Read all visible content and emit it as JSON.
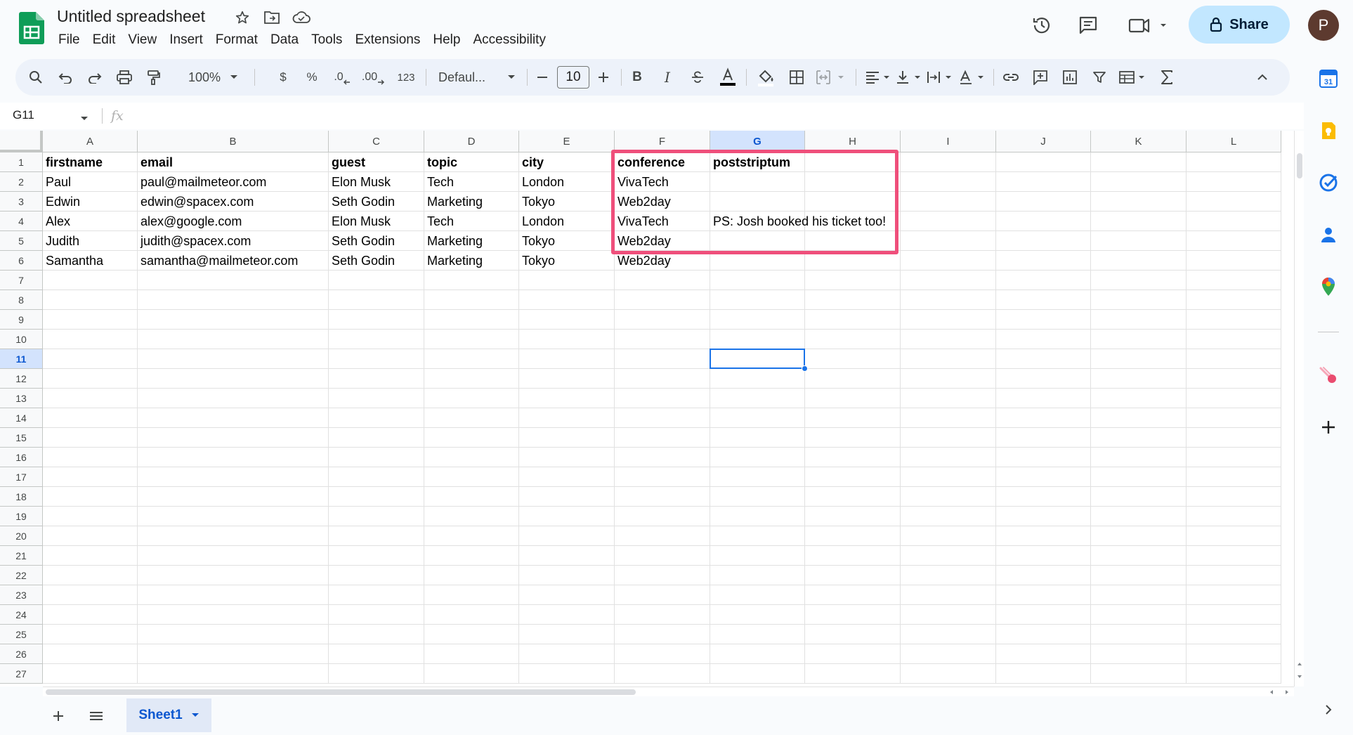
{
  "doc": {
    "title": "Untitled spreadsheet"
  },
  "menu": [
    "File",
    "Edit",
    "View",
    "Insert",
    "Format",
    "Data",
    "Tools",
    "Extensions",
    "Help",
    "Accessibility"
  ],
  "header": {
    "share_label": "Share",
    "avatar_initial": "P"
  },
  "toolbar": {
    "zoom": "100%",
    "currency": "$",
    "percent": "%",
    "decimal_decrease": ".0",
    "decimal_increase": ".00",
    "number_format": "123",
    "font": "Defaul...",
    "font_size": "10",
    "bold": "B",
    "italic": "I"
  },
  "formula": {
    "cell_ref": "G11",
    "fx": "fx"
  },
  "columns": [
    "A",
    "B",
    "C",
    "D",
    "E",
    "F",
    "G",
    "H",
    "I",
    "J",
    "K",
    "L"
  ],
  "selected_column": "G",
  "row_numbers": [
    "1",
    "2",
    "3",
    "4",
    "5",
    "6",
    "7",
    "8",
    "9",
    "10",
    "11",
    "12",
    "13",
    "14",
    "15",
    "16",
    "17",
    "18",
    "19",
    "20",
    "21",
    "22",
    "23",
    "24",
    "25",
    "26",
    "27"
  ],
  "selected_row": "11",
  "cells": [
    [
      "firstname",
      "email",
      "guest",
      "topic",
      "city",
      "conference",
      "poststriptum"
    ],
    [
      "Paul",
      "paul@mailmeteor.com",
      "Elon Musk",
      "Tech",
      "London",
      "VivaTech",
      ""
    ],
    [
      "Edwin",
      "edwin@spacex.com",
      "Seth Godin",
      "Marketing",
      "Tokyo",
      "Web2day",
      ""
    ],
    [
      "Alex",
      "alex@google.com",
      "Elon Musk",
      "Tech",
      "London",
      "VivaTech",
      "PS: Josh booked his ticket too!"
    ],
    [
      "Judith",
      "judith@spacex.com",
      "Seth Godin",
      "Marketing",
      "Tokyo",
      "Web2day",
      ""
    ],
    [
      "Samantha",
      "samantha@mailmeteor.com",
      "Seth Godin",
      "Marketing",
      "Tokyo",
      "Web2day",
      ""
    ]
  ],
  "sheet": {
    "name": "Sheet1"
  },
  "colors": {
    "highlight": "#ef4f7b",
    "selection": "#1a73e8",
    "share_bg": "#c2e7ff",
    "brand": "#0f9d58"
  }
}
